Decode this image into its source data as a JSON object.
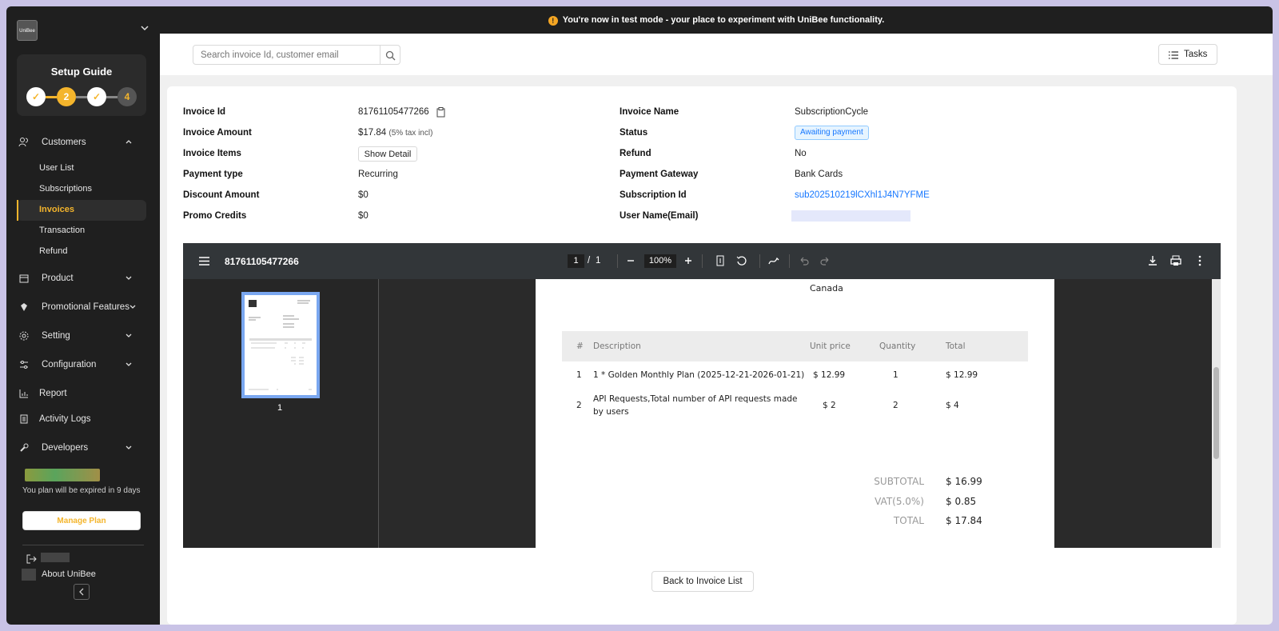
{
  "app": {
    "logo_text": "UniBee"
  },
  "banner": {
    "text": "You're now in test mode - your place to experiment with UniBee functionality."
  },
  "setup_guide": {
    "title": "Setup Guide",
    "steps": [
      "✓",
      "2",
      "✓",
      "4"
    ]
  },
  "sidebar": {
    "customers": "Customers",
    "sub_items": [
      "User List",
      "Subscriptions",
      "Invoices",
      "Transaction",
      "Refund"
    ],
    "product": "Product",
    "promotional": "Promotional Features",
    "setting": "Setting",
    "configuration": "Configuration",
    "report": "Report",
    "activity_logs": "Activity Logs",
    "developers": "Developers",
    "plan_notice": "You plan will be expired in 9 days",
    "manage_plan": "Manage Plan",
    "about": "About UniBee"
  },
  "header": {
    "search_placeholder": "Search invoice Id, customer email",
    "tasks_label": "Tasks"
  },
  "invoice": {
    "labels_left": [
      "Invoice Id",
      "Invoice Amount",
      "Invoice Items",
      "Payment type",
      "Discount Amount",
      "Promo Credits"
    ],
    "labels_right": [
      "Invoice Name",
      "Status",
      "Refund",
      "Payment Gateway",
      "Subscription Id",
      "User Name(Email)"
    ],
    "invoice_id": "81761105477266",
    "amount": "$17.84",
    "amount_note": "(5% tax incl)",
    "show_detail": "Show Detail",
    "payment_type": "Recurring",
    "discount_amount": "$0",
    "promo_credits": "$0",
    "invoice_name": "SubscriptionCycle",
    "status": "Awaiting payment",
    "refund": "No",
    "payment_gateway": "Bank Cards",
    "subscription_id": "sub202510219lCXhl1J4N7YFME"
  },
  "pdf": {
    "title": "81761105477266",
    "page_current": "1",
    "page_sep": "/",
    "page_total": "1",
    "zoom": "100%",
    "thumb_number": "1",
    "country": "Canada",
    "table_headers": [
      "#",
      "Description",
      "Unit price",
      "Quantity",
      "Total"
    ],
    "rows": [
      {
        "num": "1",
        "desc1": "1 * Golden Monthly Plan (2025-12-21-2026-01-21)",
        "desc2": "",
        "unit": "$ 12.99",
        "qty": "1",
        "total": "$ 12.99"
      },
      {
        "num": "2",
        "desc1": "API Requests,Total number of API requests made",
        "desc2": "by users",
        "unit": "$ 2",
        "qty": "2",
        "total": "$ 4"
      }
    ],
    "subtotal_label": "SUBTOTAL",
    "subtotal": "$ 16.99",
    "vat_label": "VAT(5.0%)",
    "vat": "$ 0.85",
    "total_label": "TOTAL",
    "total": "$ 17.84"
  },
  "footer": {
    "back_button": "Back to Invoice List"
  },
  "colors": {
    "accent": "#f4b52c",
    "sidebar_bg": "#1f1f1f",
    "link": "#1677ff"
  }
}
